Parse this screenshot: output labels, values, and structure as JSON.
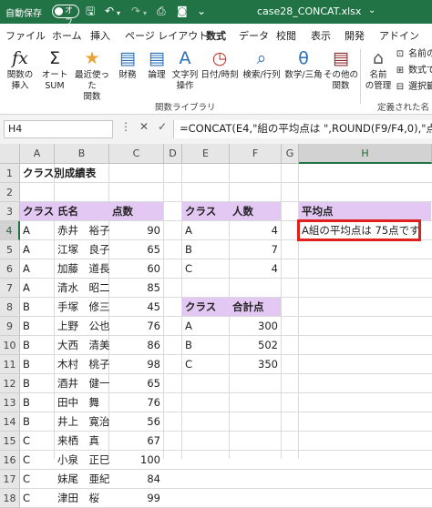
{
  "titlebar": {
    "autosave_label": "自動保存",
    "toggle_state": "オフ",
    "filename": "case28_CONCAT.xlsx"
  },
  "tabs": [
    "ファイル",
    "ホーム",
    "挿入",
    "ページ レイアウト",
    "数式",
    "データ",
    "校閲",
    "表示",
    "開発",
    "アドイン"
  ],
  "active_tab": "数式",
  "ribbon": {
    "insert_function": "関数の\n挿入",
    "autosum": "オート\nSUM",
    "recent": "最近使った\n関数",
    "financial": "財務",
    "logical": "論理",
    "text": "文字列\n操作",
    "datetime": "日付/時刻",
    "lookup": "検索/行列",
    "math": "数学/三角",
    "more": "その他の\n関数",
    "name_manager": "名前\nの管理",
    "define_name": "名前の定",
    "use_in_formula": "数式で使",
    "create_from_selection": "選択範",
    "group_library": "関数ライブラリ",
    "group_defined_names": "定義された名"
  },
  "formula_bar": {
    "name_box": "H4",
    "fx": "fx",
    "formula": "=CONCAT(E4,\"組の平均点は \",ROUND(F9/F4,0),\"点です"
  },
  "columns": [
    "A",
    "B",
    "C",
    "D",
    "E",
    "F",
    "G",
    "H"
  ],
  "rows": [
    "1",
    "2",
    "3",
    "4",
    "5",
    "6",
    "7",
    "8",
    "9",
    "10",
    "11",
    "12",
    "13",
    "14",
    "15",
    "16",
    "17",
    "18"
  ],
  "sheet": {
    "title": "クラス別成績表",
    "table1_headers": [
      "クラス",
      "氏名",
      "点数"
    ],
    "table1_rows": [
      [
        "A",
        "赤井　裕子",
        "90"
      ],
      [
        "A",
        "江塚　良子",
        "65"
      ],
      [
        "A",
        "加藤　道長",
        "60"
      ],
      [
        "A",
        "清水　昭二",
        "85"
      ],
      [
        "B",
        "手塚　修三",
        "45"
      ],
      [
        "B",
        "上野　公也",
        "76"
      ],
      [
        "B",
        "大西　清美",
        "86"
      ],
      [
        "B",
        "木村　桃子",
        "98"
      ],
      [
        "B",
        "酒井　健一",
        "65"
      ],
      [
        "B",
        "田中　舞",
        "76"
      ],
      [
        "B",
        "井上　寛治",
        "56"
      ],
      [
        "C",
        "来栖　真",
        "67"
      ],
      [
        "C",
        "小泉　正巳",
        "100"
      ],
      [
        "C",
        "妹尾　亜紀",
        "84"
      ],
      [
        "C",
        "津田　桜",
        "99"
      ]
    ],
    "table2_headers": [
      "クラス",
      "人数"
    ],
    "table2_rows": [
      [
        "A",
        "4"
      ],
      [
        "B",
        "7"
      ],
      [
        "C",
        "4"
      ]
    ],
    "table3_headers": [
      "クラス",
      "合計点"
    ],
    "table3_rows": [
      [
        "A",
        "300"
      ],
      [
        "B",
        "502"
      ],
      [
        "C",
        "350"
      ]
    ],
    "avg_header": "平均点",
    "avg_result": "A組の平均点は 75点です"
  },
  "colors": {
    "excel_green": "#217346",
    "header_fill": "#e4c8f4",
    "selection_border": "#e0201c"
  }
}
